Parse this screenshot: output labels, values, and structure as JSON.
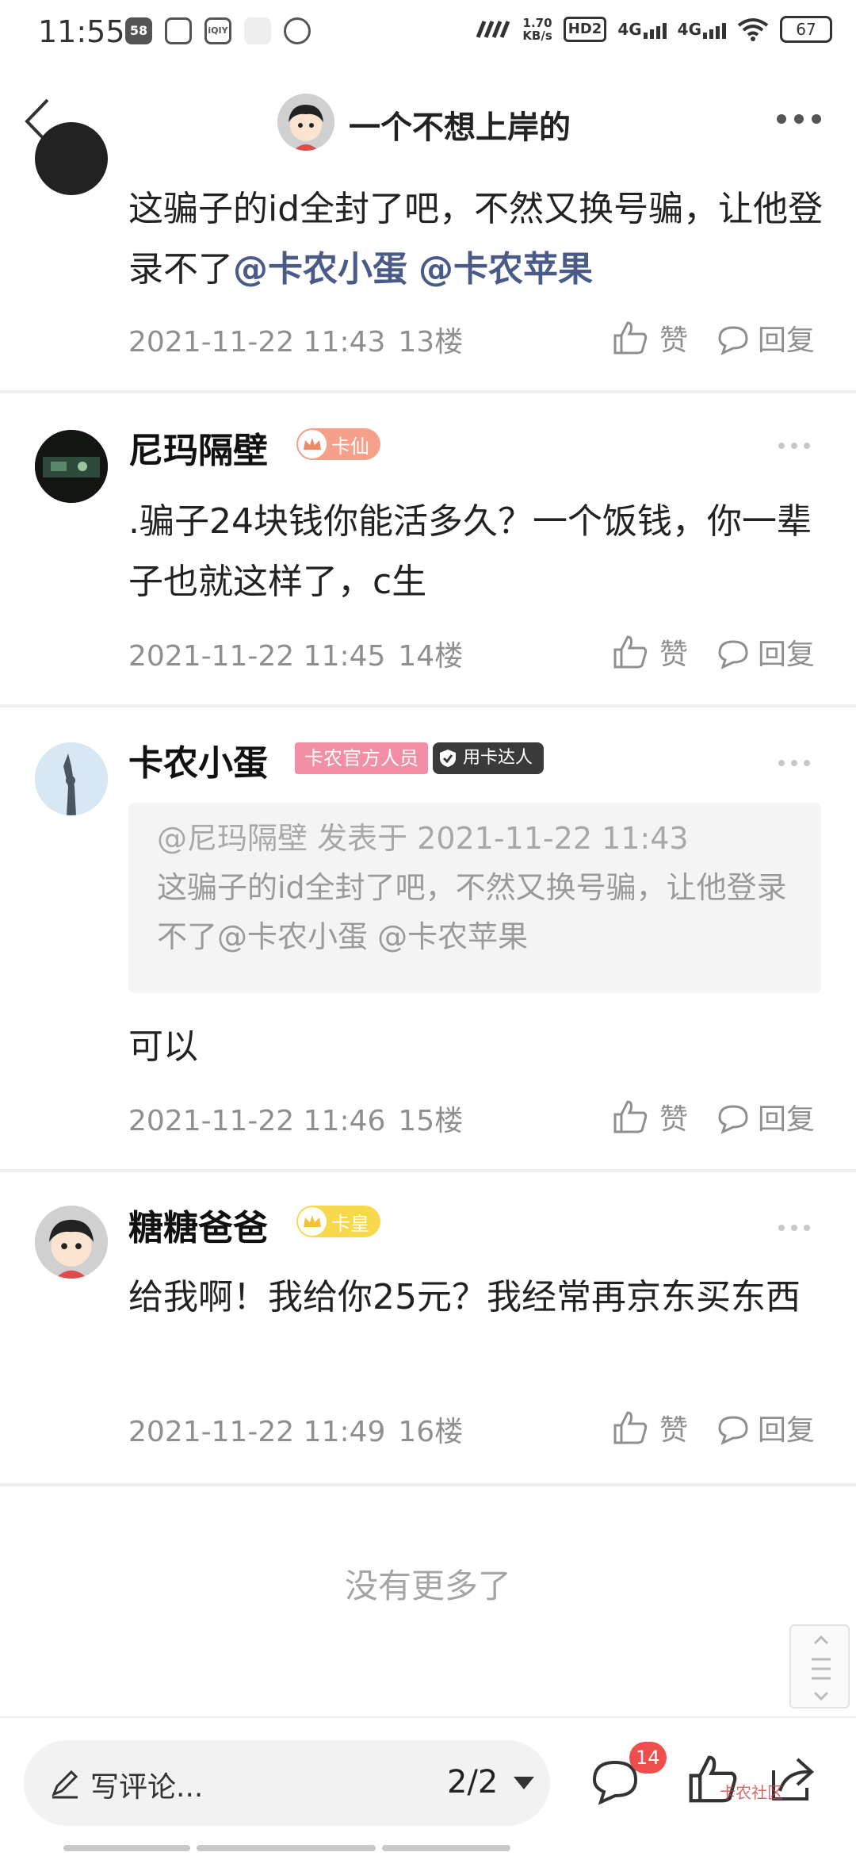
{
  "status_bar": {
    "time": "11:55",
    "app_icons": [
      "58",
      "",
      "iQIY",
      "",
      ""
    ],
    "net_speed": "1.70",
    "net_unit": "KB/s",
    "hd": "HD2",
    "sim1": "4G",
    "sim2": "4G",
    "battery": "67"
  },
  "header": {
    "title": "一个不想上岸的"
  },
  "comments": [
    {
      "text_plain": "这骗子的id全封了吧，不然又换号骗，让他登录不了",
      "mentions": [
        "@卡农小蛋",
        "@卡农苹果"
      ],
      "time": "2021-11-22 11:43",
      "floor": "13楼",
      "like_label": "赞",
      "reply_label": "回复"
    },
    {
      "author": "尼玛隔壁",
      "level_badge": "卡仙",
      "text": ".骗子24块钱你能活多久？一个饭钱，你一辈子也就这样了，c生",
      "time": "2021-11-22 11:45",
      "floor": "14楼",
      "like_label": "赞",
      "reply_label": "回复"
    },
    {
      "author": "卡农小蛋",
      "official_badge": "卡农官方人员",
      "expert_badge": "用卡达人",
      "quote_meta": "@尼玛隔壁 发表于 2021-11-22 11:43",
      "quote_text": "这骗子的id全封了吧，不然又换号骗，让他登录不了@卡农小蛋 @卡农苹果",
      "text": "可以",
      "time": "2021-11-22 11:46",
      "floor": "15楼",
      "like_label": "赞",
      "reply_label": "回复"
    },
    {
      "author": "糖糖爸爸",
      "level_badge": "卡皇",
      "text": "给我啊！我给你25元？我经常再京东买东西",
      "time": "2021-11-22 11:49",
      "floor": "16楼",
      "like_label": "赞",
      "reply_label": "回复"
    }
  ],
  "no_more": "没有更多了",
  "bottom_bar": {
    "write_placeholder": "写评论...",
    "page_indicator": "2/2",
    "comment_count": "14",
    "watermark": "卡农社区"
  },
  "colors": {
    "mention": "#4a5b87",
    "level_xian": "#f5a08a",
    "level_huang": "#f7d84c",
    "official": "#f28fa6",
    "badge_red": "#f04d4d"
  }
}
